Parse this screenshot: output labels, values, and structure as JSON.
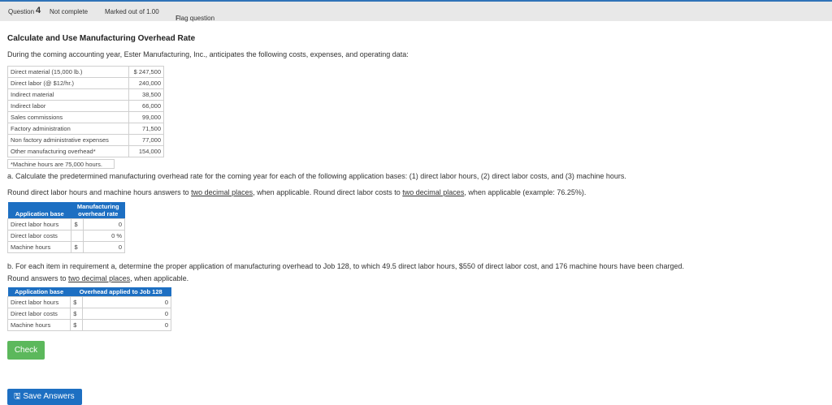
{
  "header": {
    "question_label": "Question",
    "question_number": "4",
    "status": "Not complete",
    "marked": "Marked out of 1.00",
    "flag": "Flag question"
  },
  "title": "Calculate and Use Manufacturing Overhead Rate",
  "intro": "During the coming accounting year, Ester Manufacturing, Inc., anticipates the following costs, expenses, and operating data:",
  "data_rows": [
    {
      "label": "Direct material (15,000 lb.)",
      "value": "$ 247,500"
    },
    {
      "label": "Direct labor (@ $12/hr.)",
      "value": "240,000"
    },
    {
      "label": "Indirect material",
      "value": "38,500"
    },
    {
      "label": "Indirect labor",
      "value": "66,000"
    },
    {
      "label": "Sales commissions",
      "value": "99,000"
    },
    {
      "label": "Factory administration",
      "value": "71,500"
    },
    {
      "label": "Non factory administrative expenses",
      "value": "77,000"
    },
    {
      "label": "Other manufacturing overhead*",
      "value": "154,000"
    }
  ],
  "footnote": "*Machine hours are 75,000 hours.",
  "part_a": {
    "line1": "a. Calculate the predetermined manufacturing overhead rate for the coming year for each of the following application bases: (1) direct labor hours, (2) direct labor costs, and (3) machine hours.",
    "line2_pre": "Round direct labor hours and machine hours answers to ",
    "line2_u1": "two decimal places",
    "line2_mid": ", when applicable. Round direct labor costs to ",
    "line2_u2": "two decimal places",
    "line2_post": ", when applicable (example: 76.25%).",
    "table": {
      "col1": "Application base",
      "col2_line1": "Manufacturing",
      "col2_line2": "overhead rate",
      "rows": [
        {
          "label": "Direct labor hours",
          "prefix": "$",
          "value": "0",
          "suffix": ""
        },
        {
          "label": "Direct labor costs",
          "prefix": "",
          "value": "0",
          "suffix": "%"
        },
        {
          "label": "Machine hours",
          "prefix": "$",
          "value": "0",
          "suffix": ""
        }
      ]
    }
  },
  "part_b": {
    "line1": "b. For each item in requirement a, determine the proper application of manufacturing overhead to Job 128, to which 49.5 direct labor hours, $550 of direct labor cost, and 176 machine hours have been charged.",
    "line2_pre": "Round answers to ",
    "line2_u": "two decimal places",
    "line2_post": ", when applicable.",
    "table": {
      "col1": "Application base",
      "col2": "Overhead applied to Job 128",
      "rows": [
        {
          "label": "Direct labor hours",
          "prefix": "$",
          "value": "0"
        },
        {
          "label": "Direct labor costs",
          "prefix": "$",
          "value": "0"
        },
        {
          "label": "Machine hours",
          "prefix": "$",
          "value": "0"
        }
      ]
    }
  },
  "buttons": {
    "check": "Check",
    "save": "Save Answers"
  },
  "icons": {
    "flag": "flag-icon",
    "save": "floppy-disk-icon"
  }
}
